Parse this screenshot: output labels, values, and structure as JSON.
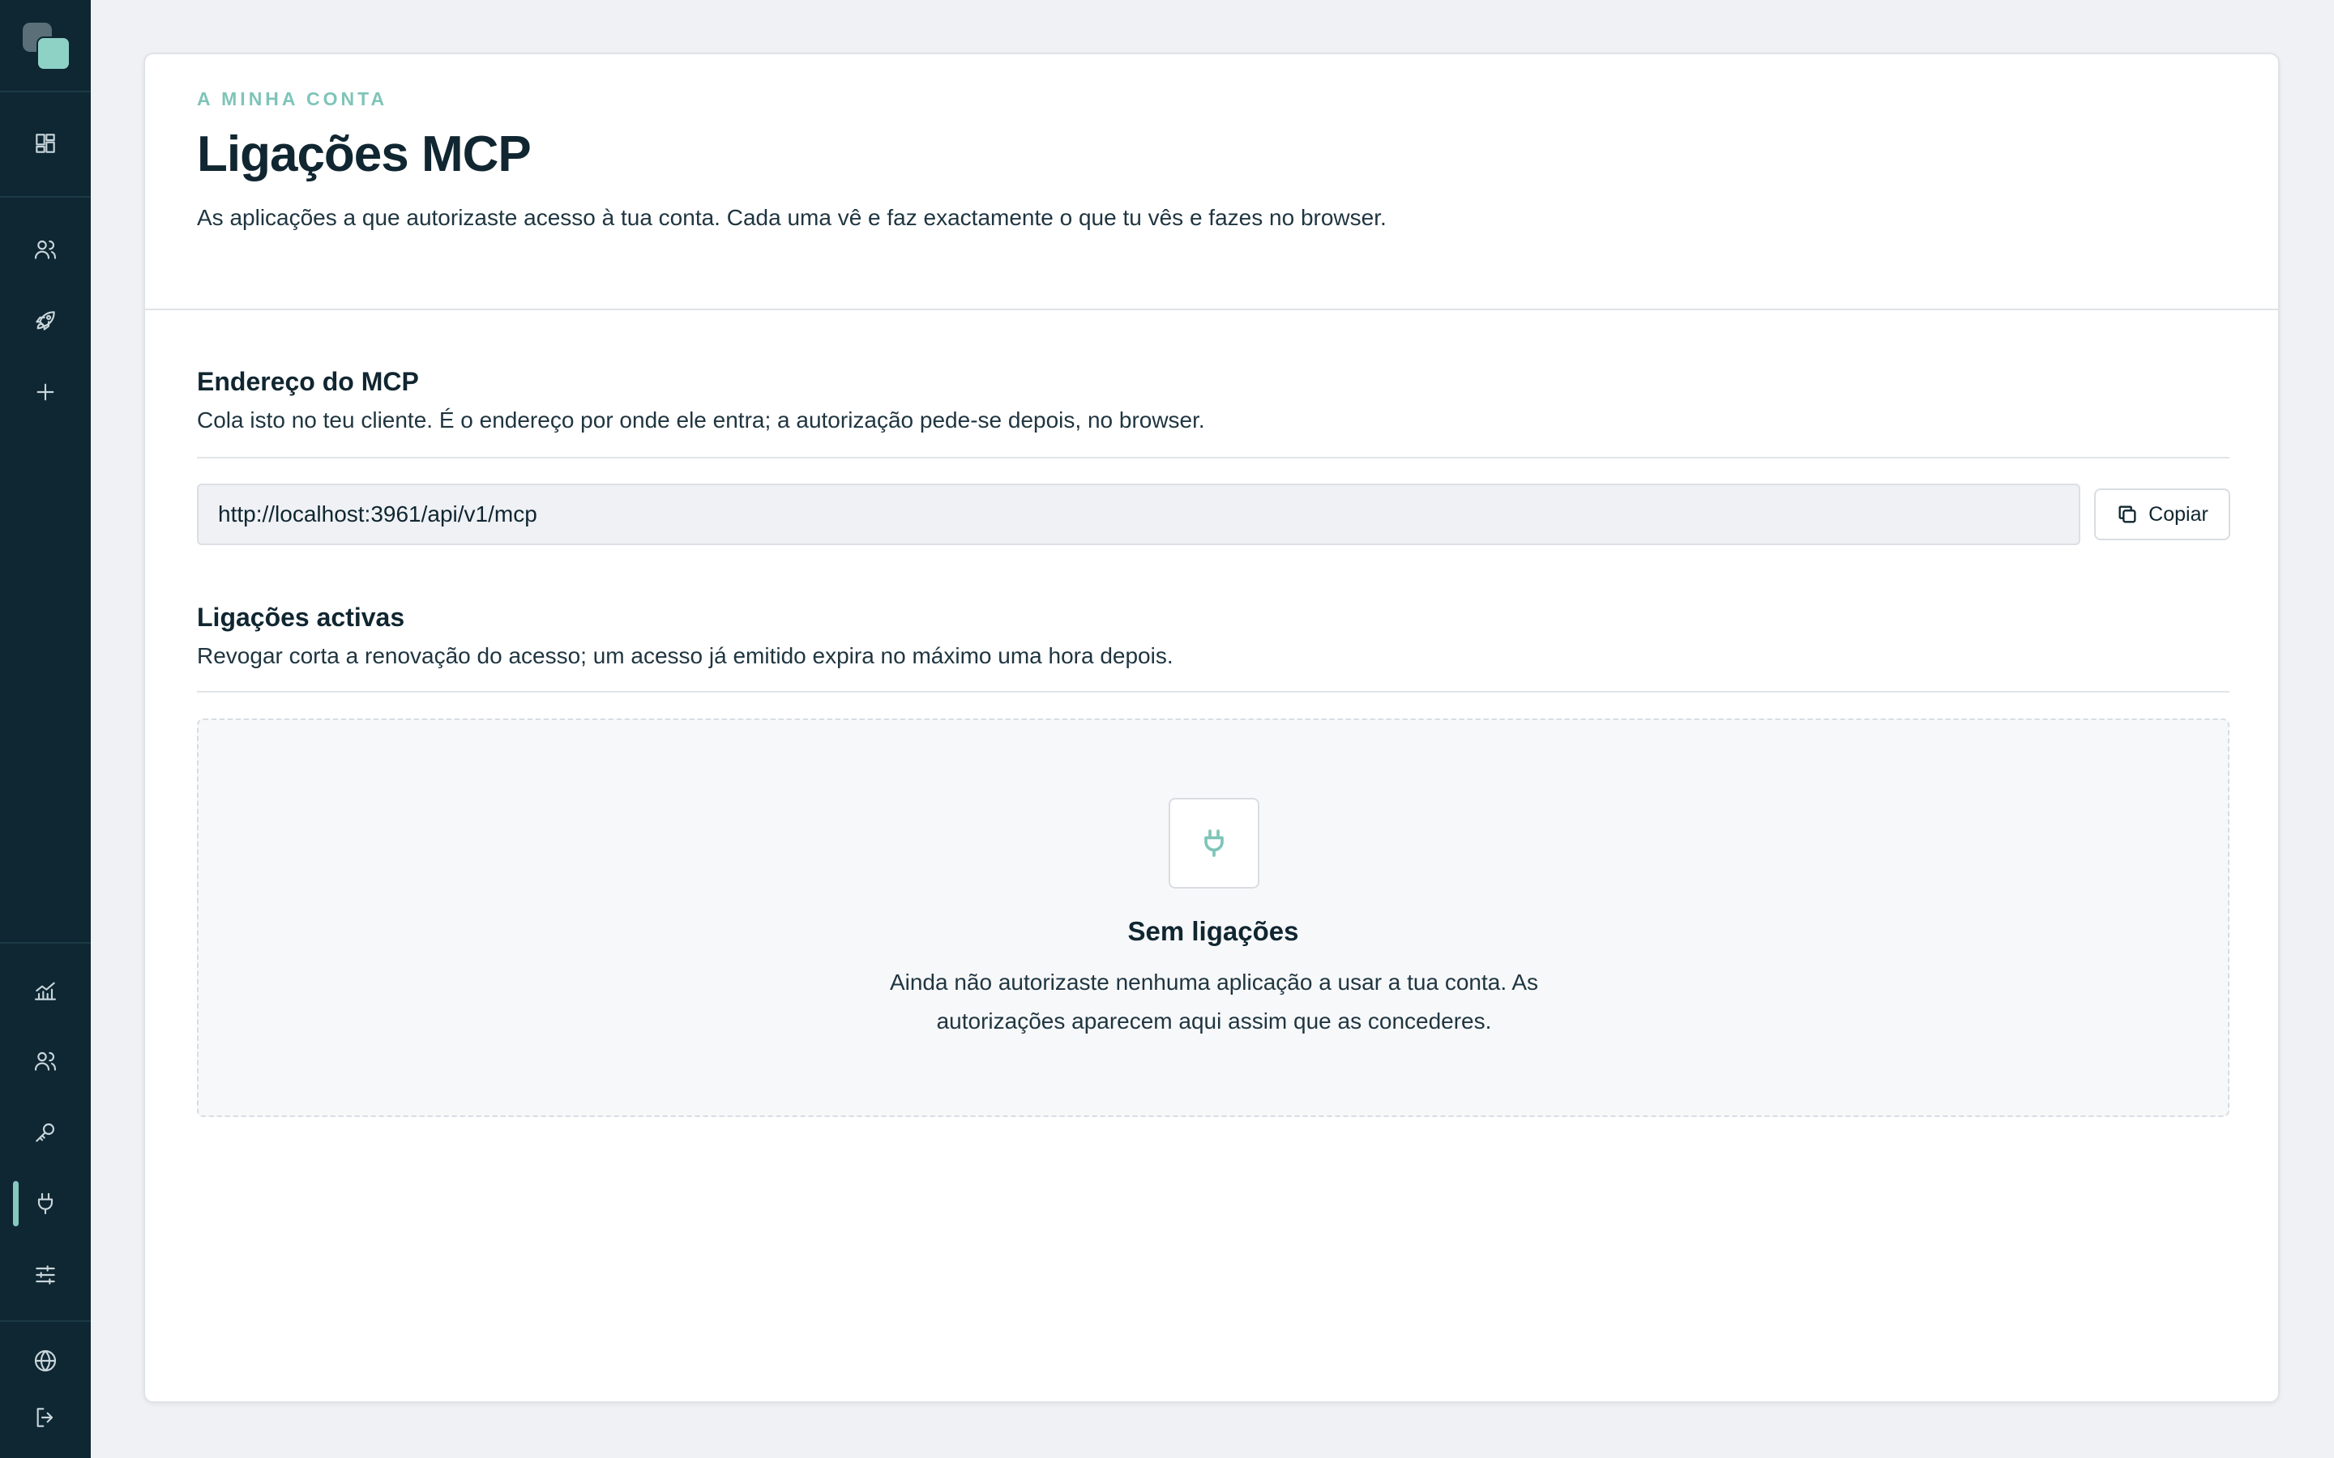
{
  "sidebar": {
    "top_icons": [
      "dashboard-icon",
      "users-icon",
      "rocket-icon",
      "plus-icon"
    ],
    "bottom_icons": [
      "analytics-icon",
      "team-icon",
      "key-icon",
      "plug-icon",
      "sliders-icon"
    ],
    "footer_icons": [
      "globe-icon",
      "logout-icon"
    ],
    "active_item": "plug-icon",
    "accent_color": "#85c9be",
    "background_color": "#0e2732"
  },
  "header": {
    "eyebrow": "A MINHA CONTA",
    "title": "Ligações MCP",
    "description": "As aplicações a que autorizaste acesso à tua conta. Cada uma vê e faz exactamente o que tu vês e fazes no browser."
  },
  "mcp_address": {
    "title": "Endereço do MCP",
    "description": "Cola isto no teu cliente. É o endereço por onde ele entra; a autorização pede-se depois, no browser.",
    "url": "http://localhost:3961/api/v1/mcp",
    "copy_label": "Copiar"
  },
  "active_connections": {
    "title": "Ligações activas",
    "description": "Revogar corta a renovação do acesso; um acesso já emitido expira no máximo uma hora depois.",
    "empty_title": "Sem ligações",
    "empty_description": "Ainda não autorizaste nenhuma aplicação a usar a tua conta. As autorizações aparecem aqui assim que as concederes."
  }
}
